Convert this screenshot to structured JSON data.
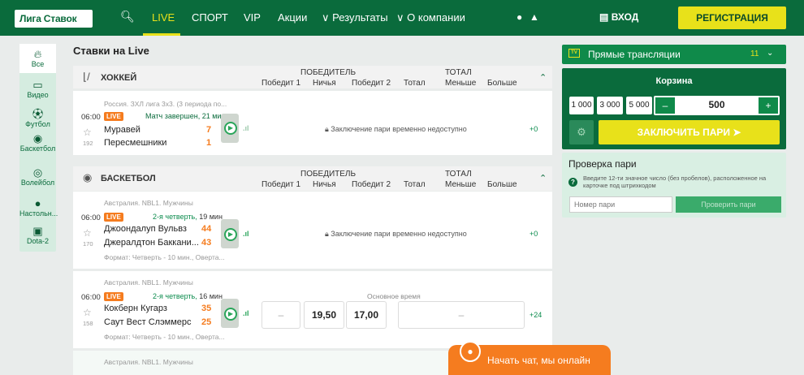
{
  "header": {
    "logo": "Лига Ставок",
    "nav": [
      "LIVE",
      "СПОРТ",
      "VIP",
      "Акции",
      "Результаты",
      "О компании"
    ],
    "login": "ВХОД",
    "register": "РЕГИСТРАЦИЯ"
  },
  "sidebar": {
    "items": [
      {
        "label": "Все",
        "icon": "fire-icon"
      },
      {
        "label": "Видео",
        "icon": "monitor-icon"
      },
      {
        "label": "Футбол",
        "icon": "soccer-ball-icon"
      },
      {
        "label": "Баскетбол",
        "icon": "basketball-icon"
      },
      {
        "label": "Волейбол",
        "icon": "volleyball-icon"
      },
      {
        "label": "Настольн...",
        "icon": "table-tennis-icon"
      },
      {
        "label": "Dota-2",
        "icon": "dota-icon"
      }
    ]
  },
  "main": {
    "title": "Ставки на Live",
    "cols": {
      "winner": "ПОБЕДИТЕЛЬ",
      "total": "ТОТАЛ",
      "w1": "Победит 1",
      "draw": "Ничья",
      "w2": "Победит 2",
      "tot": "Тотал",
      "less": "Меньше",
      "more": "Больше"
    },
    "sections": [
      {
        "name": "ХОККЕЙ",
        "events": [
          {
            "league": "Россия. ЗХЛ лига 3х3. (3 периода по...",
            "time": "06:00",
            "live": "LIVE",
            "status": "Матч завершен, 21 мин",
            "team1": "Муравей",
            "score1": "7",
            "team2": "Пересмешники",
            "score2": "1",
            "num": "192",
            "locked": "Заключение пари временно недоступно",
            "more": "+0"
          }
        ]
      },
      {
        "name": "БАСКЕТБОЛ",
        "events": [
          {
            "league": "Австралия. NBL1. Мужчины",
            "time": "06:00",
            "live": "LIVE",
            "status_period": "2-я четверть,",
            "status_min": "19 мин",
            "team1": "Джоондалуп Вульвз",
            "score1": "44",
            "team2": "Джералдтон Баккани...",
            "score2": "43",
            "num": "170",
            "format": "Формат: Четверть - 10 мин., Оверта...",
            "locked": "Заключение пари временно недоступно",
            "more": "+0"
          },
          {
            "league": "Австралия. NBL1. Мужчины",
            "time": "06:00",
            "live": "LIVE",
            "status_period": "2-я четверть,",
            "status_min": "16 мин",
            "team1": "Кокберн Кугарз",
            "score1": "35",
            "team2": "Саут Вест Слэммерс",
            "score2": "25",
            "num": "158",
            "format": "Формат: Четверть - 10 мин., Оверта...",
            "main_time": "Основное время",
            "odds": [
              "–",
              "19,50",
              "17,00",
              "–"
            ],
            "more": "+24"
          },
          {
            "league": "Австралия. NBL1. Мужчины"
          }
        ]
      }
    ]
  },
  "right": {
    "streams": {
      "title": "Прямые трансляции",
      "count": "11"
    },
    "basket": {
      "title": "Корзина",
      "presets": [
        "1 000",
        "3 000",
        "5 000"
      ],
      "minus": "–",
      "amount": "500",
      "plus": "+",
      "place_bet": "ЗАКЛЮЧИТЬ ПАРИ"
    },
    "check": {
      "title": "Проверка пари",
      "hint": "Введите 12-ти значное число (без пробелов), расположенное на карточке под штрихкодом",
      "placeholder": "Номер пари",
      "button": "Проверить пари"
    }
  },
  "chat": {
    "label": "Начать чат, мы онлайн"
  }
}
